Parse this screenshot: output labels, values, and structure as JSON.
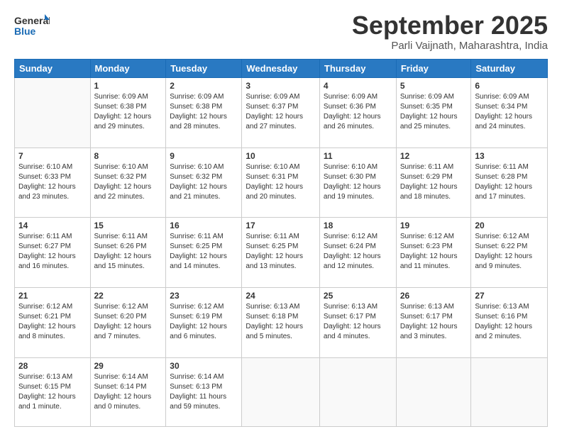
{
  "header": {
    "logo_line1": "General",
    "logo_line2": "Blue",
    "month_title": "September 2025",
    "location": "Parli Vaijnath, Maharashtra, India"
  },
  "days_of_week": [
    "Sunday",
    "Monday",
    "Tuesday",
    "Wednesday",
    "Thursday",
    "Friday",
    "Saturday"
  ],
  "weeks": [
    [
      {
        "day": "",
        "info": ""
      },
      {
        "day": "1",
        "info": "Sunrise: 6:09 AM\nSunset: 6:38 PM\nDaylight: 12 hours\nand 29 minutes."
      },
      {
        "day": "2",
        "info": "Sunrise: 6:09 AM\nSunset: 6:38 PM\nDaylight: 12 hours\nand 28 minutes."
      },
      {
        "day": "3",
        "info": "Sunrise: 6:09 AM\nSunset: 6:37 PM\nDaylight: 12 hours\nand 27 minutes."
      },
      {
        "day": "4",
        "info": "Sunrise: 6:09 AM\nSunset: 6:36 PM\nDaylight: 12 hours\nand 26 minutes."
      },
      {
        "day": "5",
        "info": "Sunrise: 6:09 AM\nSunset: 6:35 PM\nDaylight: 12 hours\nand 25 minutes."
      },
      {
        "day": "6",
        "info": "Sunrise: 6:09 AM\nSunset: 6:34 PM\nDaylight: 12 hours\nand 24 minutes."
      }
    ],
    [
      {
        "day": "7",
        "info": "Sunrise: 6:10 AM\nSunset: 6:33 PM\nDaylight: 12 hours\nand 23 minutes."
      },
      {
        "day": "8",
        "info": "Sunrise: 6:10 AM\nSunset: 6:32 PM\nDaylight: 12 hours\nand 22 minutes."
      },
      {
        "day": "9",
        "info": "Sunrise: 6:10 AM\nSunset: 6:32 PM\nDaylight: 12 hours\nand 21 minutes."
      },
      {
        "day": "10",
        "info": "Sunrise: 6:10 AM\nSunset: 6:31 PM\nDaylight: 12 hours\nand 20 minutes."
      },
      {
        "day": "11",
        "info": "Sunrise: 6:10 AM\nSunset: 6:30 PM\nDaylight: 12 hours\nand 19 minutes."
      },
      {
        "day": "12",
        "info": "Sunrise: 6:11 AM\nSunset: 6:29 PM\nDaylight: 12 hours\nand 18 minutes."
      },
      {
        "day": "13",
        "info": "Sunrise: 6:11 AM\nSunset: 6:28 PM\nDaylight: 12 hours\nand 17 minutes."
      }
    ],
    [
      {
        "day": "14",
        "info": "Sunrise: 6:11 AM\nSunset: 6:27 PM\nDaylight: 12 hours\nand 16 minutes."
      },
      {
        "day": "15",
        "info": "Sunrise: 6:11 AM\nSunset: 6:26 PM\nDaylight: 12 hours\nand 15 minutes."
      },
      {
        "day": "16",
        "info": "Sunrise: 6:11 AM\nSunset: 6:25 PM\nDaylight: 12 hours\nand 14 minutes."
      },
      {
        "day": "17",
        "info": "Sunrise: 6:11 AM\nSunset: 6:25 PM\nDaylight: 12 hours\nand 13 minutes."
      },
      {
        "day": "18",
        "info": "Sunrise: 6:12 AM\nSunset: 6:24 PM\nDaylight: 12 hours\nand 12 minutes."
      },
      {
        "day": "19",
        "info": "Sunrise: 6:12 AM\nSunset: 6:23 PM\nDaylight: 12 hours\nand 11 minutes."
      },
      {
        "day": "20",
        "info": "Sunrise: 6:12 AM\nSunset: 6:22 PM\nDaylight: 12 hours\nand 9 minutes."
      }
    ],
    [
      {
        "day": "21",
        "info": "Sunrise: 6:12 AM\nSunset: 6:21 PM\nDaylight: 12 hours\nand 8 minutes."
      },
      {
        "day": "22",
        "info": "Sunrise: 6:12 AM\nSunset: 6:20 PM\nDaylight: 12 hours\nand 7 minutes."
      },
      {
        "day": "23",
        "info": "Sunrise: 6:12 AM\nSunset: 6:19 PM\nDaylight: 12 hours\nand 6 minutes."
      },
      {
        "day": "24",
        "info": "Sunrise: 6:13 AM\nSunset: 6:18 PM\nDaylight: 12 hours\nand 5 minutes."
      },
      {
        "day": "25",
        "info": "Sunrise: 6:13 AM\nSunset: 6:17 PM\nDaylight: 12 hours\nand 4 minutes."
      },
      {
        "day": "26",
        "info": "Sunrise: 6:13 AM\nSunset: 6:17 PM\nDaylight: 12 hours\nand 3 minutes."
      },
      {
        "day": "27",
        "info": "Sunrise: 6:13 AM\nSunset: 6:16 PM\nDaylight: 12 hours\nand 2 minutes."
      }
    ],
    [
      {
        "day": "28",
        "info": "Sunrise: 6:13 AM\nSunset: 6:15 PM\nDaylight: 12 hours\nand 1 minute."
      },
      {
        "day": "29",
        "info": "Sunrise: 6:14 AM\nSunset: 6:14 PM\nDaylight: 12 hours\nand 0 minutes."
      },
      {
        "day": "30",
        "info": "Sunrise: 6:14 AM\nSunset: 6:13 PM\nDaylight: 11 hours\nand 59 minutes."
      },
      {
        "day": "",
        "info": ""
      },
      {
        "day": "",
        "info": ""
      },
      {
        "day": "",
        "info": ""
      },
      {
        "day": "",
        "info": ""
      }
    ]
  ]
}
